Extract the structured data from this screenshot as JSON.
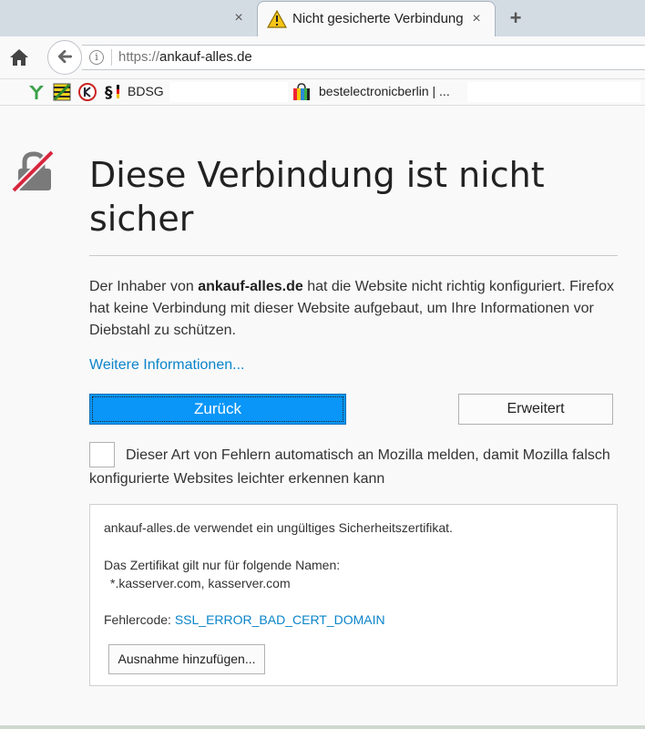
{
  "tabs": {
    "active_title": "Nicht gesicherte Verbindung",
    "close_glyph": "×",
    "new_tab_glyph": "+"
  },
  "navbar": {
    "url_protocol": "https://",
    "url_host": "ankauf-alles.de",
    "info_glyph": "i"
  },
  "bookmarks": {
    "items": [
      {
        "label": "BDSG"
      },
      {
        "label": "bestelectronicberlin | ..."
      }
    ]
  },
  "error_page": {
    "title": "Diese Verbindung ist nicht sicher",
    "desc_prefix": "Der Inhaber von ",
    "desc_host": "ankauf-alles.de",
    "desc_suffix": " hat die Website nicht richtig konfiguriert. Firefox hat keine Verbindung mit dieser Website aufgebaut, um Ihre Informationen vor Diebstahl zu schützen.",
    "more_info_link": "Weitere Informationen...",
    "back_button": "Zurück",
    "advanced_button": "Erweitert",
    "report_checkbox_label": "Dieser Art von Fehlern automatisch an Mozilla melden, damit Mozilla falsch konfigurierte Websites leichter erkennen kann",
    "details": {
      "invalid_cert_text": "ankauf-alles.de verwendet ein ungültiges Sicherheitszertifikat.",
      "valid_names_label": "Das Zertifikat gilt nur für folgende Namen:",
      "valid_names": "*.kasserver.com, kasserver.com",
      "error_code_label": "Fehlercode: ",
      "error_code": "SSL_ERROR_BAD_CERT_DOMAIN",
      "add_exception_button": "Ausnahme hinzufügen..."
    }
  },
  "colors": {
    "accent_blue": "#0996f8",
    "link_blue": "#0a84c9",
    "warning_yellow": "#f5c518",
    "lock_strike_red": "#d7263d"
  }
}
